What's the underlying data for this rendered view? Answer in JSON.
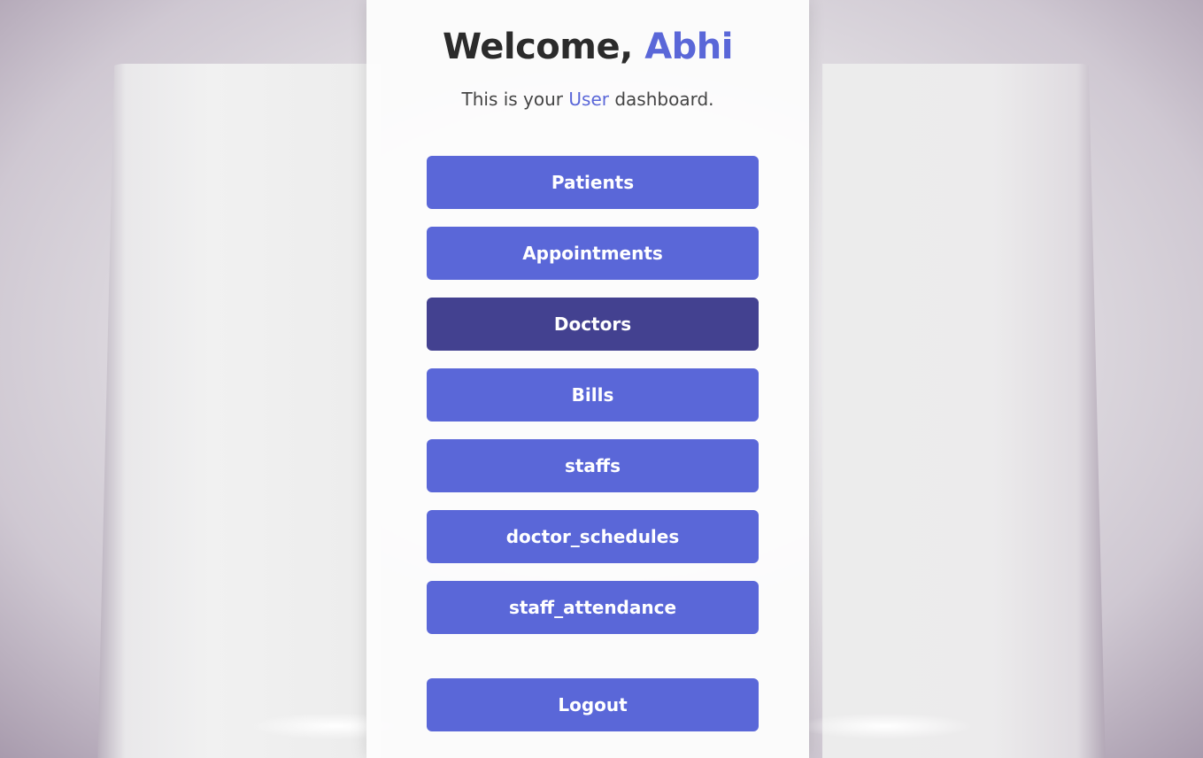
{
  "header": {
    "welcome_prefix": "Welcome, ",
    "user_name": "Abhi",
    "subtitle_before": "This is your ",
    "role": "User",
    "subtitle_after": " dashboard."
  },
  "nav": {
    "items": [
      {
        "label": "Patients"
      },
      {
        "label": "Appointments"
      },
      {
        "label": "Doctors",
        "active": true
      },
      {
        "label": "Bills"
      },
      {
        "label": "staffs"
      },
      {
        "label": "doctor_schedules"
      },
      {
        "label": "staff_attendance"
      }
    ]
  },
  "logout_label": "Logout",
  "colors": {
    "accent": "#5a67d8",
    "accent_active": "#434190",
    "text": "#2b2b2b"
  }
}
